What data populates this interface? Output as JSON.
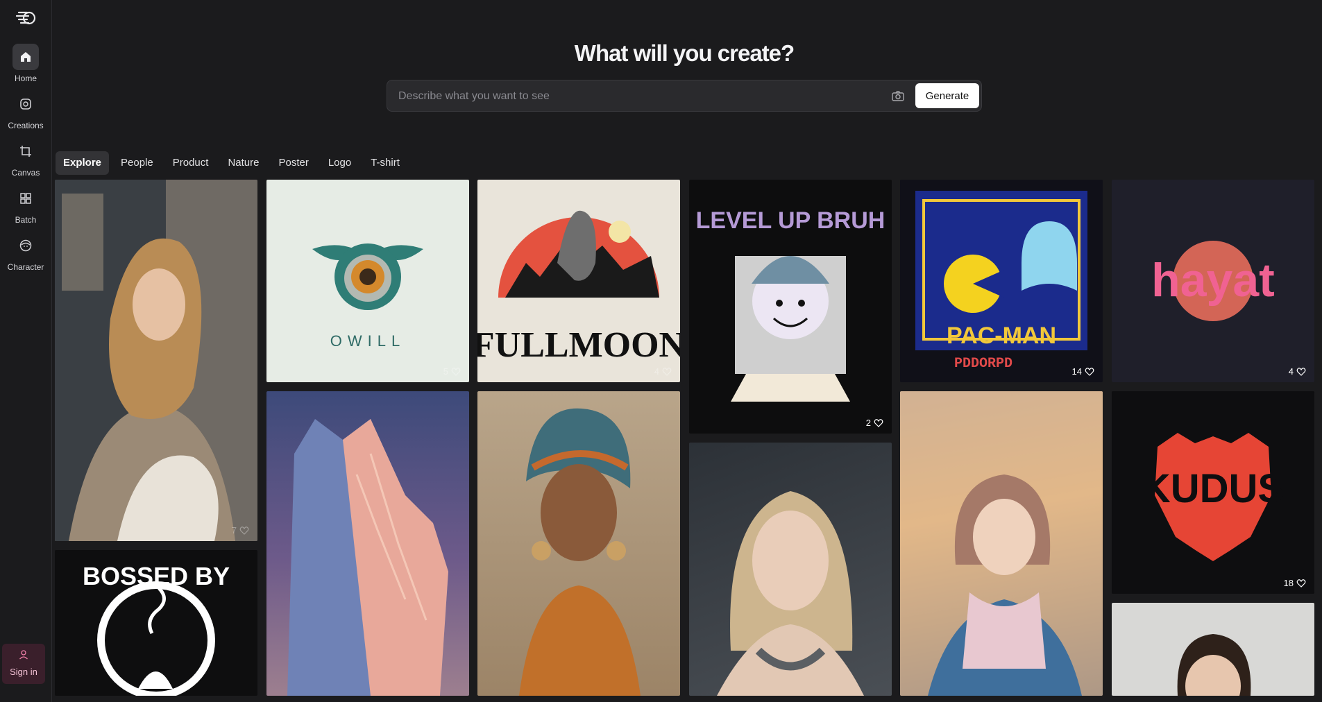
{
  "sidebar": {
    "items": [
      {
        "label": "Home",
        "icon": "home-icon",
        "active": true
      },
      {
        "label": "Creations",
        "icon": "image-icon"
      },
      {
        "label": "Canvas",
        "icon": "crop-icon"
      },
      {
        "label": "Batch",
        "icon": "grid-icon"
      },
      {
        "label": "Character",
        "icon": "face-icon"
      }
    ],
    "signin_label": "Sign in"
  },
  "header": {
    "title": "What will you create?"
  },
  "search": {
    "placeholder": "Describe what you want to see",
    "generate_label": "Generate"
  },
  "tabs": [
    "Explore",
    "People",
    "Product",
    "Nature",
    "Poster",
    "Logo",
    "T-shirt"
  ],
  "gallery": {
    "logo_owill_text": "OWILL",
    "fullmoon_text": "FULLMOON",
    "levelup_text": "LEVEL UP BRUH",
    "pacman_text": "PAC-MAN",
    "pacman_sub": "PDDORPD",
    "hayat_text": "hayat",
    "kudus_text": "KUDUS",
    "bossed_text": "BOSSED BY",
    "likes": {
      "owill": "5",
      "fullmoon": "4",
      "levelup": "2",
      "pacman": "14",
      "hayat": "4",
      "kudus": "18",
      "woman_salon": "7"
    }
  },
  "colors": {
    "background": "#1b1b1d",
    "accent_signin": "#3a1f2b",
    "button_bg": "#ffffff"
  }
}
